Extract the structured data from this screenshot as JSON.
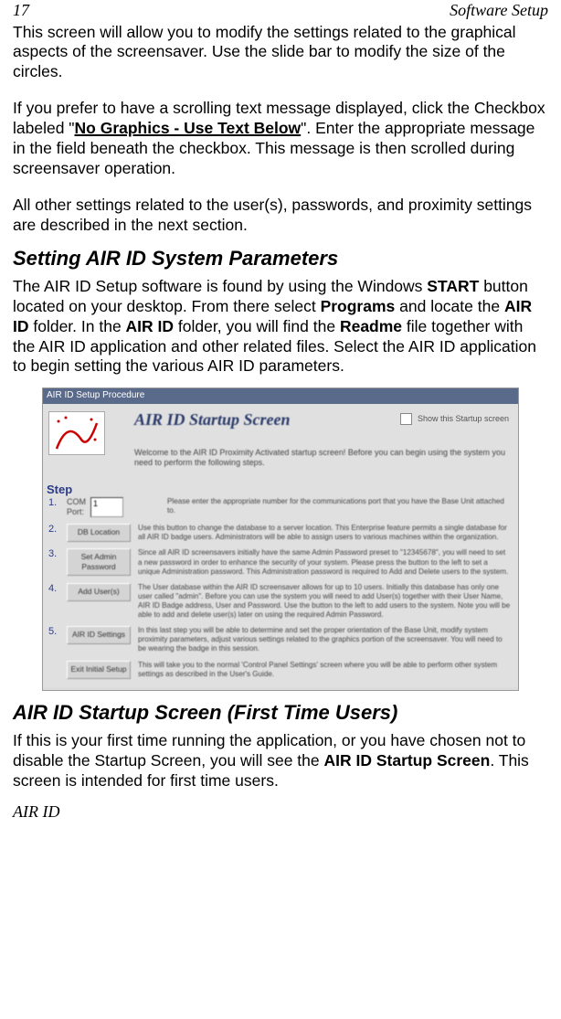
{
  "header": {
    "page_number": "17",
    "section_title": "Software Setup"
  },
  "paragraphs": {
    "p1": "This screen will allow you to modify the settings related to the graphical aspects of the screensaver.  Use the slide bar to modify the size of the circles.",
    "p2_a": "If you prefer to have a scrolling text message displayed, click the Checkbox labeled \"",
    "p2_bold": "No Graphics - Use Text Below",
    "p2_b": "\".  Enter the appropriate message in the field beneath the checkbox.  This message is then scrolled during screensaver operation.",
    "p3": "All other settings related to the user(s), passwords, and proximity settings are described in the next section."
  },
  "heading1": "Setting AIR ID System Parameters",
  "p4": {
    "a": "The AIR ID Setup software is found by using the Windows ",
    "b1": "START",
    "c": " button located on your desktop.  From there select ",
    "b2": "Programs",
    "d": " and locate the ",
    "b3": "AIR ID",
    "e": " folder.  In the ",
    "b4": "AIR ID",
    "f": " folder, you will find the ",
    "b5": "Readme",
    "g": " file together with the AIR ID application and other related files.  Select the AIR ID application to begin setting the various AIR ID parameters."
  },
  "screenshot": {
    "titlebar": "AIR ID Setup Procedure",
    "panel_title": "AIR ID Startup Screen",
    "checkbox_label": "Show this Startup screen",
    "intro": "Welcome to the AIR ID Proximity Activated startup screen!  Before you can begin using the system you need to perform the following steps.",
    "step_label": "Step",
    "steps": [
      {
        "num": "1.",
        "field_value": "1",
        "desc": "Please enter the appropriate number for the communications port that you have the Base Unit attached to."
      },
      {
        "num": "2.",
        "button": "DB Location",
        "desc": "Use this button to change the database to a server location.  This Enterprise feature permits a single database for all AIR ID badge users.  Administrators will be able to assign users to various machines within the organization."
      },
      {
        "num": "3.",
        "button": "Set Admin Password",
        "desc": "Since all AIR ID screensavers initially have the same Admin Password preset to \"12345678\", you will need to set a new password in order to enhance the security of your system.  Please press the button to the left to set a unique Administration password.  This Administration password is required to Add and Delete users to the system."
      },
      {
        "num": "4.",
        "button": "Add User(s)",
        "desc": "The User database within the AIR ID screensaver allows for up to 10 users.  Initially this database has only one user called \"admin\".  Before you can use the system you will need to add User(s) together with their User Name, AIR ID Badge address, User and Password.  Use the button to the left to add users to the system.  Note you will be able to add and delete user(s) later on using the required Admin Password."
      },
      {
        "num": "5.",
        "button": "AIR ID Settings",
        "desc": "In this last step you will be able to determine and set the proper orientation of the Base Unit, modify system proximity parameters, adjust various settings related to the graphics portion of the screensaver.  You will need to be wearing the badge in this session."
      },
      {
        "num": "",
        "button": "Exit Initial Setup",
        "desc": "This will take you to the normal 'Control Panel Settings' screen where you will be able to perform other system settings as described in the User's Guide."
      }
    ]
  },
  "heading2": "AIR ID Startup Screen (First Time Users)",
  "p5": {
    "a": "If this is your first time running the application, or you have chosen not to disable the Startup Screen, you will see the ",
    "b1": "AIR ID Startup Screen",
    "c": ". This screen is intended for first time users."
  },
  "footer": "AIR ID"
}
